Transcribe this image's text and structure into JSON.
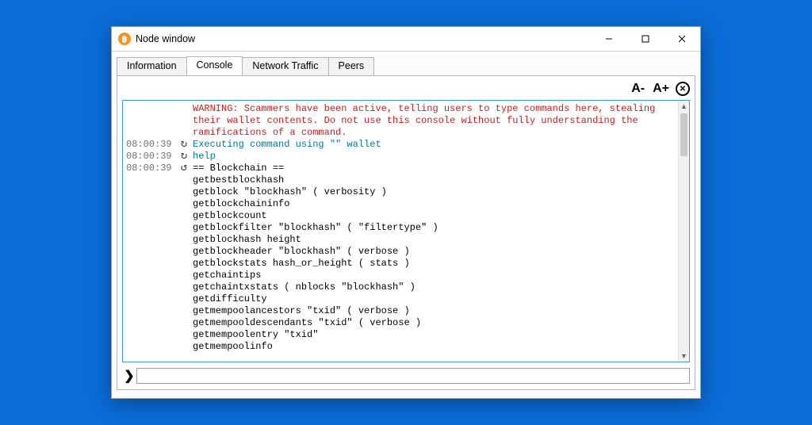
{
  "window": {
    "title": "Node window",
    "icon_glyph": "฿"
  },
  "tabs": [
    {
      "label": "Information",
      "active": false
    },
    {
      "label": "Console",
      "active": true
    },
    {
      "label": "Network Traffic",
      "active": false
    },
    {
      "label": "Peers",
      "active": false
    }
  ],
  "toolbar": {
    "font_dec": "A-",
    "font_inc": "A+",
    "clear_glyph": "✕"
  },
  "console": {
    "warning": [
      "WARNING: Scammers have been active, telling users to type commands here, stealing",
      "their wallet contents. Do not use this console without fully understanding the",
      "ramifications of a command."
    ],
    "rows": [
      {
        "ts": "08:00:39",
        "icon": "↻",
        "text": "Executing command using \"\" wallet",
        "color": "blue"
      },
      {
        "ts": "08:00:39",
        "icon": "↻",
        "text": "help",
        "color": "blue"
      },
      {
        "ts": "08:00:39",
        "icon": "↺",
        "text": "== Blockchain ==",
        "color": "black"
      }
    ],
    "help_body": [
      "getbestblockhash",
      "getblock \"blockhash\" ( verbosity )",
      "getblockchaininfo",
      "getblockcount",
      "getblockfilter \"blockhash\" ( \"filtertype\" )",
      "getblockhash height",
      "getblockheader \"blockhash\" ( verbose )",
      "getblockstats hash_or_height ( stats )",
      "getchaintips",
      "getchaintxstats ( nblocks \"blockhash\" )",
      "getdifficulty",
      "getmempoolancestors \"txid\" ( verbose )",
      "getmempooldescendants \"txid\" ( verbose )",
      "getmempoolentry \"txid\"",
      "getmempoolinfo"
    ]
  },
  "prompt": {
    "chevron": "❯",
    "value": ""
  }
}
